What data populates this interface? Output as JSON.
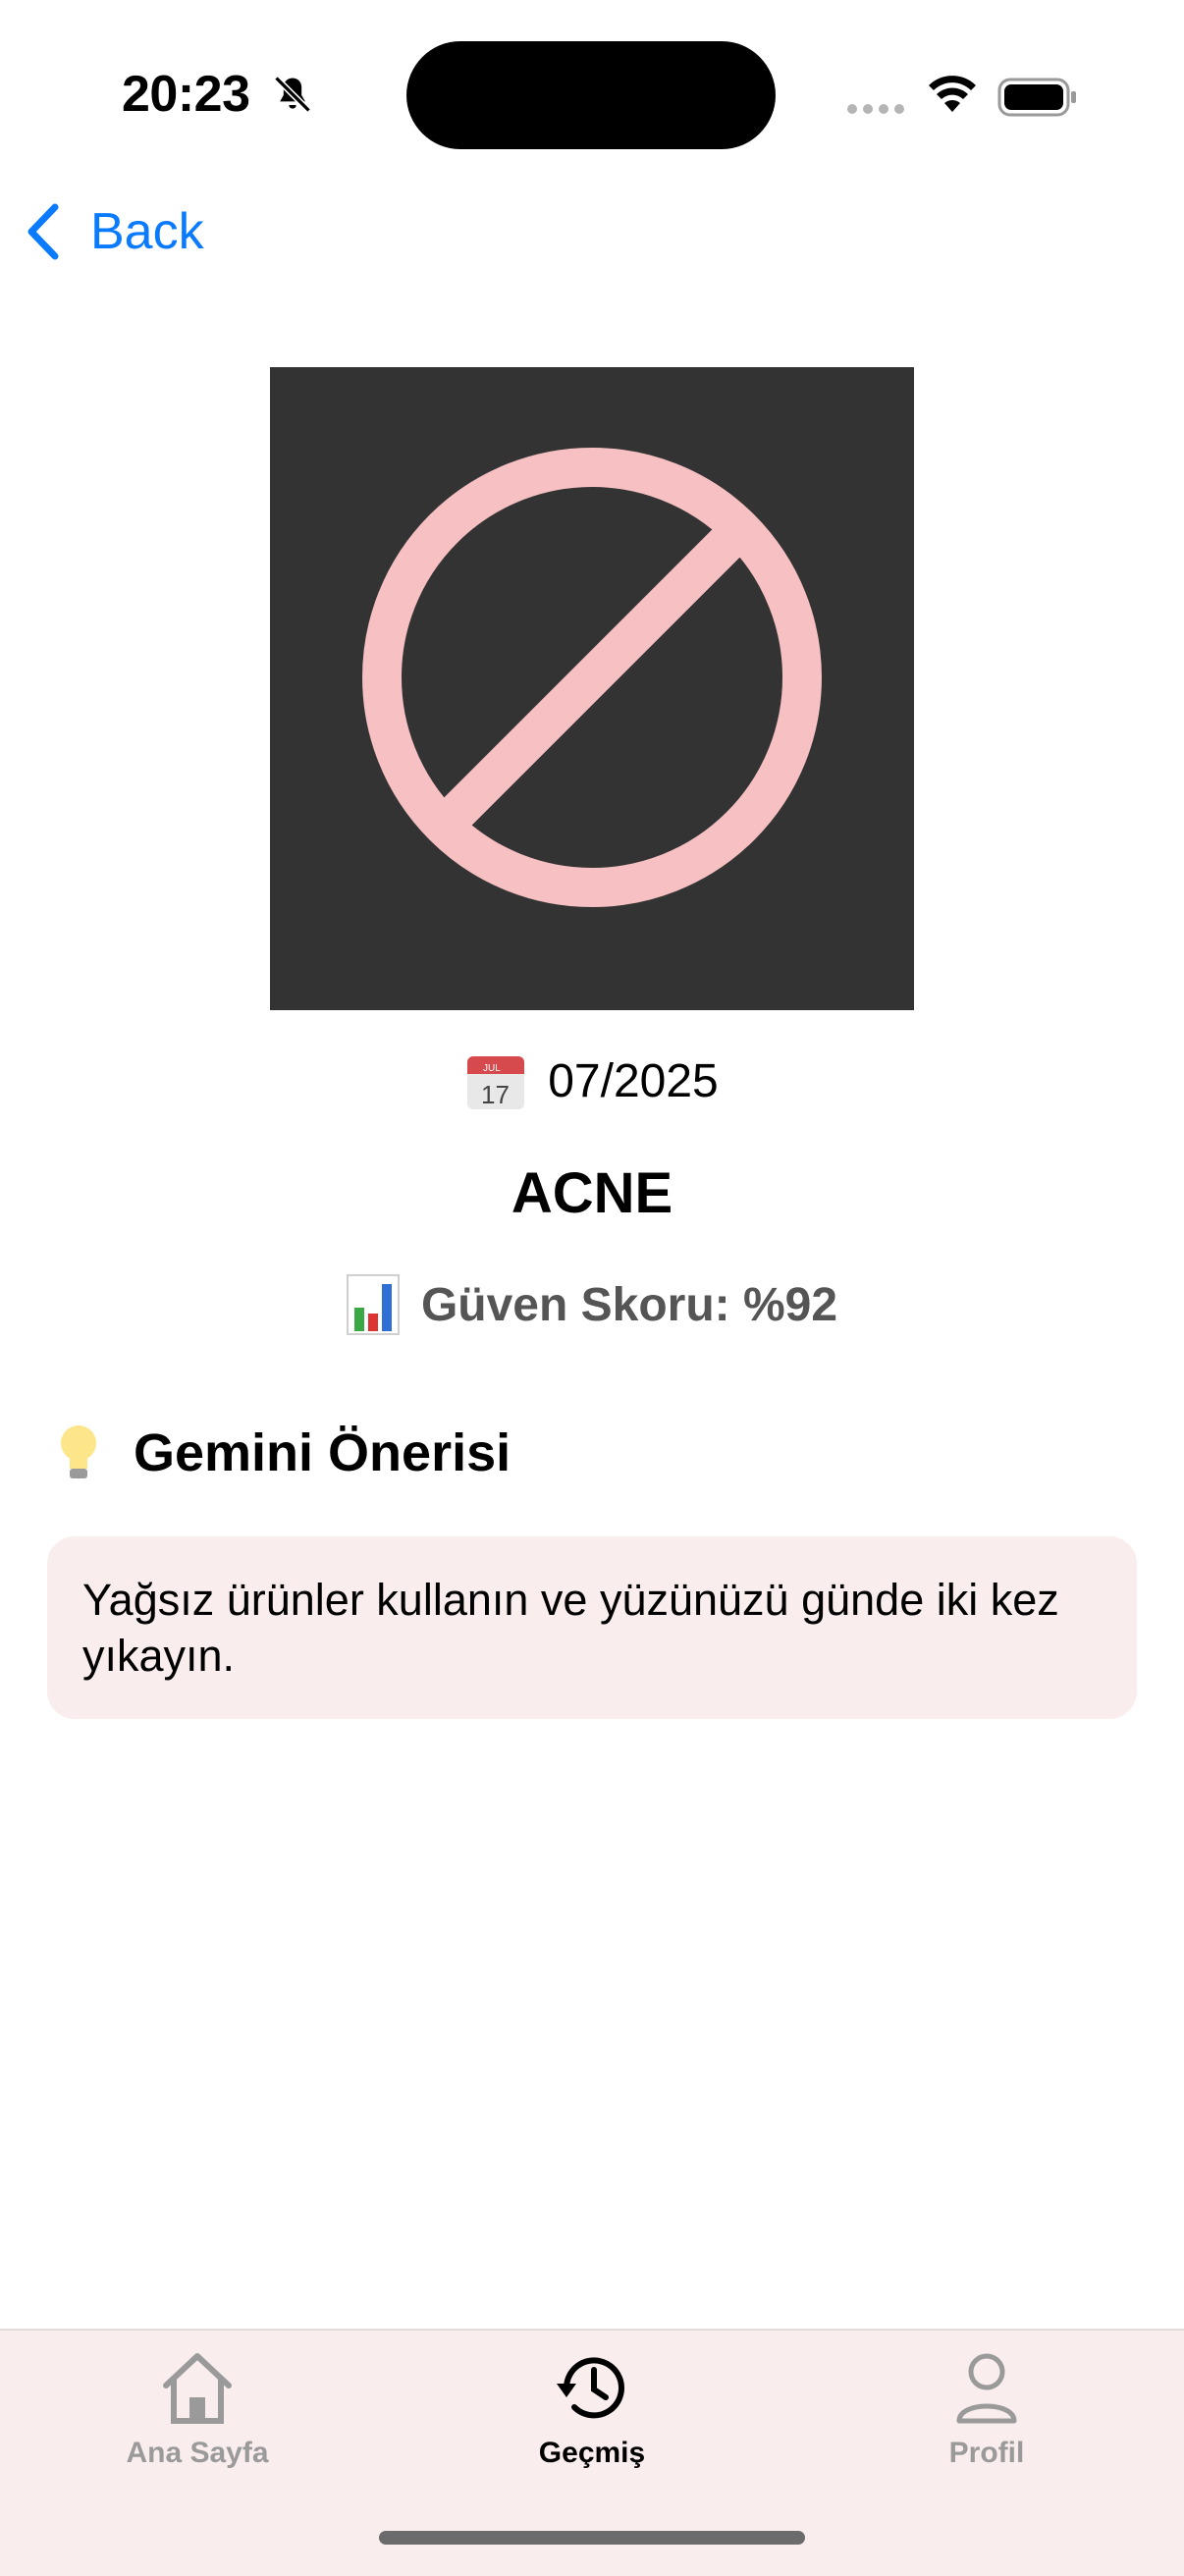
{
  "status_bar": {
    "time": "20:23",
    "icons": [
      "bell-slash-icon",
      "signal-icon",
      "wifi-icon",
      "battery-icon"
    ]
  },
  "nav": {
    "back_label": "Back"
  },
  "detail": {
    "image_icon": "prohibited-icon",
    "date_icon": "calendar-icon",
    "date": "07/2025",
    "diagnosis": "ACNE",
    "score_icon": "bar-chart-icon",
    "score_label": "Güven Skoru: %92",
    "section_icon": "lightbulb-icon",
    "section_title": "Gemini Önerisi",
    "advice": "Yağsız ürünler kullanın ve yüzünüzü günde iki kez yıkayın."
  },
  "tab_bar": {
    "tabs": [
      {
        "label": "Ana Sayfa",
        "icon": "home-icon",
        "active": false
      },
      {
        "label": "Geçmiş",
        "icon": "history-icon",
        "active": true
      },
      {
        "label": "Profil",
        "icon": "profile-icon",
        "active": false
      }
    ]
  },
  "colors": {
    "accent": "#0a7aff",
    "card_bg": "#f9eded",
    "image_bg": "#333333",
    "prohibited_pink": "#f7c0c3"
  }
}
